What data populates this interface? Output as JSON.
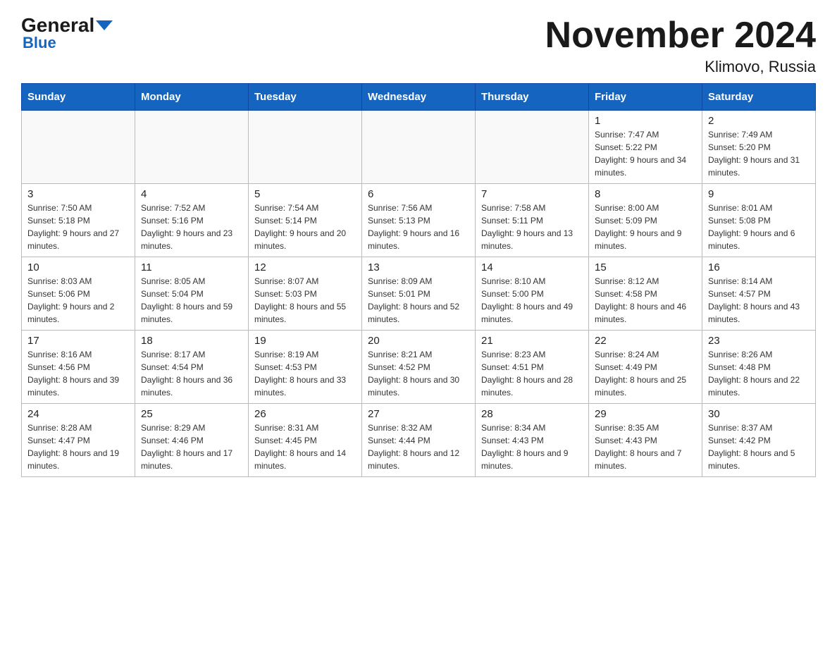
{
  "logo": {
    "text_general": "General",
    "text_blue": "Blue"
  },
  "title": "November 2024",
  "subtitle": "Klimovo, Russia",
  "days_of_week": [
    "Sunday",
    "Monday",
    "Tuesday",
    "Wednesday",
    "Thursday",
    "Friday",
    "Saturday"
  ],
  "weeks": [
    [
      {
        "day": "",
        "info": ""
      },
      {
        "day": "",
        "info": ""
      },
      {
        "day": "",
        "info": ""
      },
      {
        "day": "",
        "info": ""
      },
      {
        "day": "",
        "info": ""
      },
      {
        "day": "1",
        "info": "Sunrise: 7:47 AM\nSunset: 5:22 PM\nDaylight: 9 hours and 34 minutes."
      },
      {
        "day": "2",
        "info": "Sunrise: 7:49 AM\nSunset: 5:20 PM\nDaylight: 9 hours and 31 minutes."
      }
    ],
    [
      {
        "day": "3",
        "info": "Sunrise: 7:50 AM\nSunset: 5:18 PM\nDaylight: 9 hours and 27 minutes."
      },
      {
        "day": "4",
        "info": "Sunrise: 7:52 AM\nSunset: 5:16 PM\nDaylight: 9 hours and 23 minutes."
      },
      {
        "day": "5",
        "info": "Sunrise: 7:54 AM\nSunset: 5:14 PM\nDaylight: 9 hours and 20 minutes."
      },
      {
        "day": "6",
        "info": "Sunrise: 7:56 AM\nSunset: 5:13 PM\nDaylight: 9 hours and 16 minutes."
      },
      {
        "day": "7",
        "info": "Sunrise: 7:58 AM\nSunset: 5:11 PM\nDaylight: 9 hours and 13 minutes."
      },
      {
        "day": "8",
        "info": "Sunrise: 8:00 AM\nSunset: 5:09 PM\nDaylight: 9 hours and 9 minutes."
      },
      {
        "day": "9",
        "info": "Sunrise: 8:01 AM\nSunset: 5:08 PM\nDaylight: 9 hours and 6 minutes."
      }
    ],
    [
      {
        "day": "10",
        "info": "Sunrise: 8:03 AM\nSunset: 5:06 PM\nDaylight: 9 hours and 2 minutes."
      },
      {
        "day": "11",
        "info": "Sunrise: 8:05 AM\nSunset: 5:04 PM\nDaylight: 8 hours and 59 minutes."
      },
      {
        "day": "12",
        "info": "Sunrise: 8:07 AM\nSunset: 5:03 PM\nDaylight: 8 hours and 55 minutes."
      },
      {
        "day": "13",
        "info": "Sunrise: 8:09 AM\nSunset: 5:01 PM\nDaylight: 8 hours and 52 minutes."
      },
      {
        "day": "14",
        "info": "Sunrise: 8:10 AM\nSunset: 5:00 PM\nDaylight: 8 hours and 49 minutes."
      },
      {
        "day": "15",
        "info": "Sunrise: 8:12 AM\nSunset: 4:58 PM\nDaylight: 8 hours and 46 minutes."
      },
      {
        "day": "16",
        "info": "Sunrise: 8:14 AM\nSunset: 4:57 PM\nDaylight: 8 hours and 43 minutes."
      }
    ],
    [
      {
        "day": "17",
        "info": "Sunrise: 8:16 AM\nSunset: 4:56 PM\nDaylight: 8 hours and 39 minutes."
      },
      {
        "day": "18",
        "info": "Sunrise: 8:17 AM\nSunset: 4:54 PM\nDaylight: 8 hours and 36 minutes."
      },
      {
        "day": "19",
        "info": "Sunrise: 8:19 AM\nSunset: 4:53 PM\nDaylight: 8 hours and 33 minutes."
      },
      {
        "day": "20",
        "info": "Sunrise: 8:21 AM\nSunset: 4:52 PM\nDaylight: 8 hours and 30 minutes."
      },
      {
        "day": "21",
        "info": "Sunrise: 8:23 AM\nSunset: 4:51 PM\nDaylight: 8 hours and 28 minutes."
      },
      {
        "day": "22",
        "info": "Sunrise: 8:24 AM\nSunset: 4:49 PM\nDaylight: 8 hours and 25 minutes."
      },
      {
        "day": "23",
        "info": "Sunrise: 8:26 AM\nSunset: 4:48 PM\nDaylight: 8 hours and 22 minutes."
      }
    ],
    [
      {
        "day": "24",
        "info": "Sunrise: 8:28 AM\nSunset: 4:47 PM\nDaylight: 8 hours and 19 minutes."
      },
      {
        "day": "25",
        "info": "Sunrise: 8:29 AM\nSunset: 4:46 PM\nDaylight: 8 hours and 17 minutes."
      },
      {
        "day": "26",
        "info": "Sunrise: 8:31 AM\nSunset: 4:45 PM\nDaylight: 8 hours and 14 minutes."
      },
      {
        "day": "27",
        "info": "Sunrise: 8:32 AM\nSunset: 4:44 PM\nDaylight: 8 hours and 12 minutes."
      },
      {
        "day": "28",
        "info": "Sunrise: 8:34 AM\nSunset: 4:43 PM\nDaylight: 8 hours and 9 minutes."
      },
      {
        "day": "29",
        "info": "Sunrise: 8:35 AM\nSunset: 4:43 PM\nDaylight: 8 hours and 7 minutes."
      },
      {
        "day": "30",
        "info": "Sunrise: 8:37 AM\nSunset: 4:42 PM\nDaylight: 8 hours and 5 minutes."
      }
    ]
  ]
}
